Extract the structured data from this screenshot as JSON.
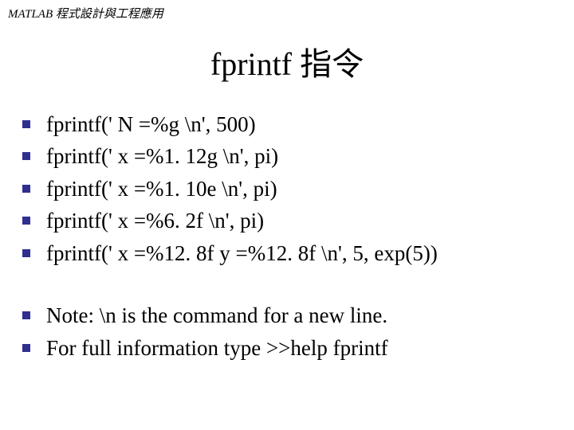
{
  "header": {
    "text": "MATLAB 程式設計與工程應用"
  },
  "title": "fprintf 指令",
  "group1": {
    "items": [
      "fprintf(' N =%g \\n', 500)",
      "fprintf(' x =%1. 12g \\n', pi)",
      "fprintf(' x =%1. 10e \\n', pi)",
      "fprintf(' x =%6. 2f \\n', pi)",
      "fprintf(' x =%12. 8f y =%12. 8f \\n', 5, exp(5))"
    ]
  },
  "group2": {
    "items": [
      "Note: \\n is the command for a new line.",
      "For full information type  >>help fprintf"
    ]
  }
}
